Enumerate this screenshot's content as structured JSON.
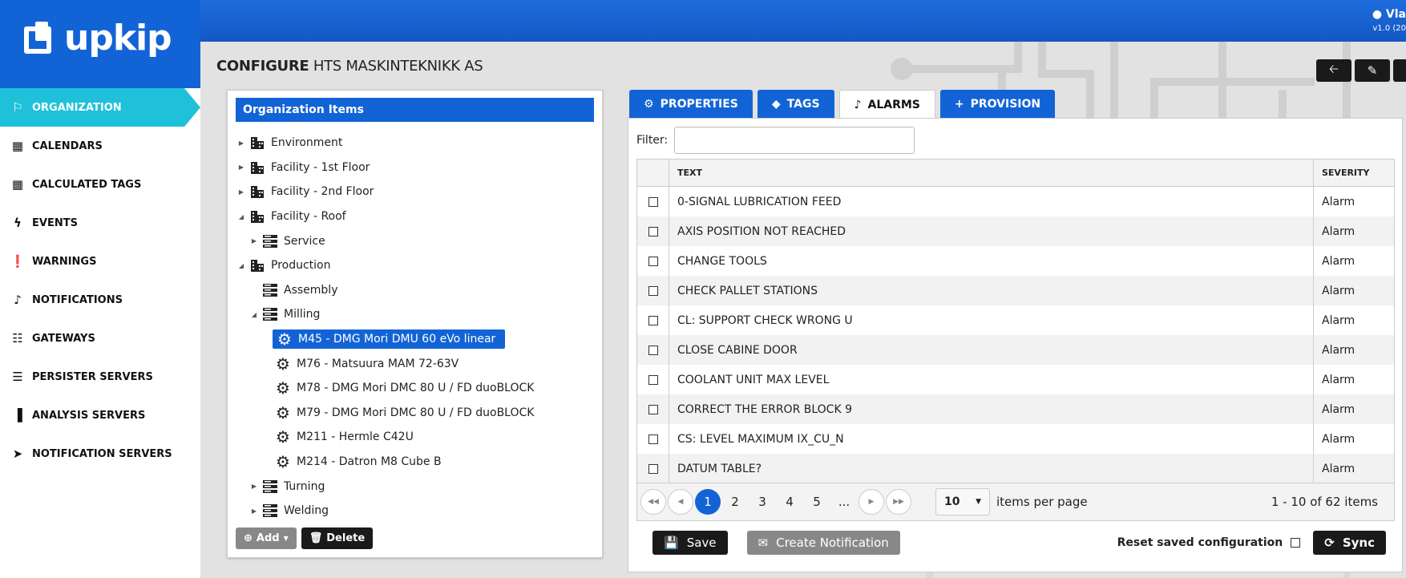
{
  "header": {
    "logo_text": "upkip",
    "user_name": "Vla",
    "version": "v1.0 (20"
  },
  "sidebar": {
    "items": [
      {
        "label": "ORGANIZATION",
        "icon": "factory-icon",
        "glyph": "⚐"
      },
      {
        "label": "CALENDARS",
        "icon": "calendar-icon",
        "glyph": "▦"
      },
      {
        "label": "CALCULATED TAGS",
        "icon": "calculator-icon",
        "glyph": "▦"
      },
      {
        "label": "EVENTS",
        "icon": "bolt-icon",
        "glyph": "ϟ"
      },
      {
        "label": "WARNINGS",
        "icon": "exclamation-icon",
        "glyph": "❗"
      },
      {
        "label": "NOTIFICATIONS",
        "icon": "bell-icon",
        "glyph": "♪"
      },
      {
        "label": "GATEWAYS",
        "icon": "sitemap-icon",
        "glyph": "☷"
      },
      {
        "label": "PERSISTER SERVERS",
        "icon": "server-icon",
        "glyph": "☰"
      },
      {
        "label": "ANALYSIS SERVERS",
        "icon": "bar-chart-icon",
        "glyph": "▐"
      },
      {
        "label": "NOTIFICATION SERVERS",
        "icon": "paper-plane-icon",
        "glyph": "➤"
      }
    ]
  },
  "page": {
    "title_bold": "CONFIGURE",
    "title_rest": " HTS MASKINTEKNIKK AS"
  },
  "org_panel": {
    "header": "Organization Items",
    "tree": [
      {
        "label": "Environment",
        "indent": 0,
        "arrow": "▶",
        "icon": "building"
      },
      {
        "label": "Facility - 1st Floor",
        "indent": 0,
        "arrow": "▶",
        "icon": "building"
      },
      {
        "label": "Facility - 2nd Floor",
        "indent": 0,
        "arrow": "▶",
        "icon": "building"
      },
      {
        "label": "Facility - Roof",
        "indent": 0,
        "arrow": "◢",
        "icon": "building"
      },
      {
        "label": "Service",
        "indent": 1,
        "arrow": "▶",
        "icon": "server"
      },
      {
        "label": "Production",
        "indent": 0,
        "arrow": "◢",
        "icon": "building"
      },
      {
        "label": "Assembly",
        "indent": 1,
        "arrow": "",
        "icon": "server"
      },
      {
        "label": "Milling",
        "indent": 1,
        "arrow": "◢",
        "icon": "server"
      },
      {
        "label": "M45 - DMG Mori DMU 60 eVo linear",
        "indent": 2,
        "arrow": "",
        "icon": "gear",
        "selected": true
      },
      {
        "label": "M76 - Matsuura MAM 72-63V",
        "indent": 2,
        "arrow": "",
        "icon": "gear"
      },
      {
        "label": "M78 - DMG Mori DMC 80 U / FD duoBLOCK",
        "indent": 2,
        "arrow": "",
        "icon": "gear"
      },
      {
        "label": "M79 - DMG Mori DMC 80 U / FD duoBLOCK",
        "indent": 2,
        "arrow": "",
        "icon": "gear"
      },
      {
        "label": "M211 - Hermle C42U",
        "indent": 2,
        "arrow": "",
        "icon": "gear"
      },
      {
        "label": "M214 - Datron M8 Cube B",
        "indent": 2,
        "arrow": "",
        "icon": "gear"
      },
      {
        "label": "Turning",
        "indent": 1,
        "arrow": "▶",
        "icon": "server"
      },
      {
        "label": "Welding",
        "indent": 1,
        "arrow": "▶",
        "icon": "server"
      }
    ],
    "add_label": "Add",
    "delete_label": "Delete"
  },
  "tabs": [
    {
      "label": "PROPERTIES",
      "glyph": "⚙",
      "icon": "gear-icon",
      "active": false
    },
    {
      "label": "TAGS",
      "glyph": "◆",
      "icon": "tag-icon",
      "active": false
    },
    {
      "label": "ALARMS",
      "glyph": "♪",
      "icon": "bell-icon",
      "active": true
    },
    {
      "label": "PROVISION",
      "glyph": "+",
      "icon": "plus-icon",
      "active": false
    }
  ],
  "alarms": {
    "filter_label": "Filter:",
    "filter_value": "",
    "columns": {
      "text": "TEXT",
      "severity": "SEVERITY"
    },
    "rows": [
      {
        "text": "0-SIGNAL LUBRICATION FEED",
        "severity": "Alarm"
      },
      {
        "text": "AXIS POSITION NOT REACHED",
        "severity": "Alarm"
      },
      {
        "text": "CHANGE TOOLS",
        "severity": "Alarm"
      },
      {
        "text": "CHECK PALLET STATIONS",
        "severity": "Alarm"
      },
      {
        "text": "CL: SUPPORT CHECK WRONG U",
        "severity": "Alarm"
      },
      {
        "text": "CLOSE CABINE DOOR",
        "severity": "Alarm"
      },
      {
        "text": "COOLANT UNIT MAX LEVEL",
        "severity": "Alarm"
      },
      {
        "text": "CORRECT THE ERROR BLOCK 9",
        "severity": "Alarm"
      },
      {
        "text": "CS: LEVEL MAXIMUM IX_CU_N",
        "severity": "Alarm"
      },
      {
        "text": "DATUM TABLE?",
        "severity": "Alarm"
      }
    ],
    "pager": {
      "pages": [
        "1",
        "2",
        "3",
        "4",
        "5",
        "..."
      ],
      "current": "1",
      "page_size": "10",
      "items_per_page_label": "items per page",
      "info": "1 - 10 of 62 items"
    },
    "save_label": "Save",
    "create_notification_label": "Create Notification",
    "reset_label": "Reset saved configuration",
    "sync_label": "Sync"
  },
  "colors": {
    "brand_blue": "#1264d6",
    "active_nav": "#1fc1da",
    "dark_button": "#1a1a1a"
  }
}
